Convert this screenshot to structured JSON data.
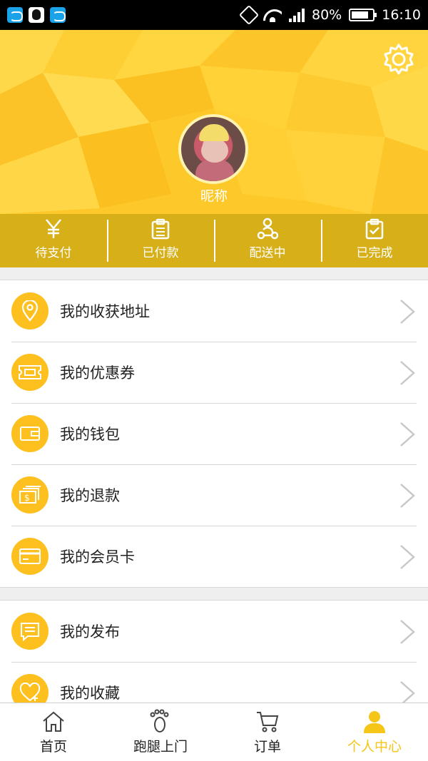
{
  "status_bar": {
    "battery": "80%",
    "time": "16:10",
    "battery_level": 0.8
  },
  "profile": {
    "nickname": "昵称"
  },
  "orders": [
    {
      "label": "待支付",
      "icon": "yen-icon"
    },
    {
      "label": "已付款",
      "icon": "clipboard-icon"
    },
    {
      "label": "配送中",
      "icon": "delivery-icon"
    },
    {
      "label": "已完成",
      "icon": "clipboard-check-icon"
    }
  ],
  "menu_group_1": [
    {
      "label": "我的收获地址",
      "icon": "location-pin-icon"
    },
    {
      "label": "我的优惠券",
      "icon": "coupon-icon"
    },
    {
      "label": "我的钱包",
      "icon": "wallet-icon"
    },
    {
      "label": "我的退款",
      "icon": "refund-icon"
    },
    {
      "label": "我的会员卡",
      "icon": "member-card-icon"
    }
  ],
  "menu_group_2": [
    {
      "label": "我的发布",
      "icon": "message-icon"
    },
    {
      "label": "我的收藏",
      "icon": "favorite-icon"
    }
  ],
  "bottom_nav": [
    {
      "label": "首页",
      "icon": "home-icon",
      "active": false
    },
    {
      "label": "跑腿上门",
      "icon": "footprint-icon",
      "active": false
    },
    {
      "label": "订单",
      "icon": "cart-icon",
      "active": false
    },
    {
      "label": "个人中心",
      "icon": "person-icon",
      "active": true
    }
  ],
  "colors": {
    "accent": "#fdc01e",
    "active_nav": "#f5c518"
  }
}
